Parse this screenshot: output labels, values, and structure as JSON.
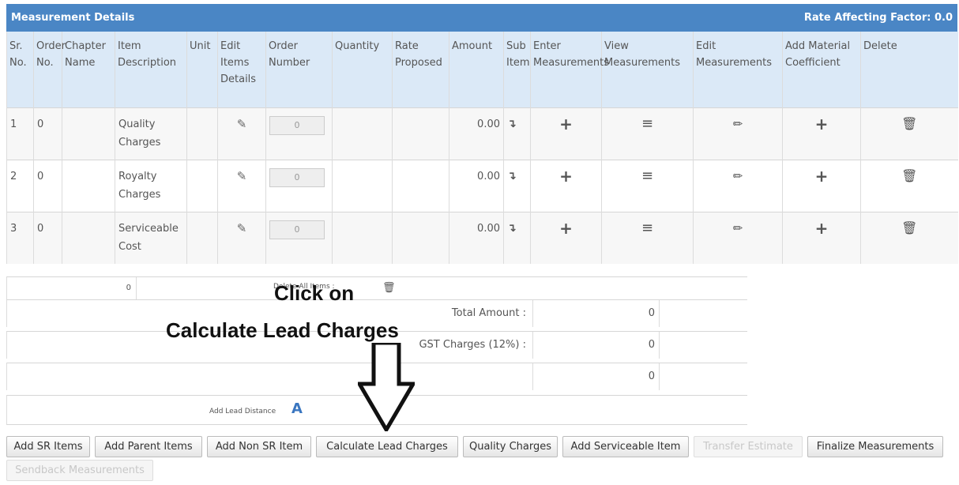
{
  "header": {
    "title": "Measurement Details",
    "rate_factor": "Rate Affecting Factor: 0.0"
  },
  "columns": {
    "sr": "Sr. No.",
    "order": "Order No.",
    "chapter": "Chapter Name",
    "item": "Item Description",
    "unit": "Unit",
    "edit_items": "Edit Items Details",
    "order_number": "Order Number",
    "quantity": "Quantity",
    "rate": "Rate Proposed",
    "amount": "Amount",
    "sub": "Sub Item",
    "enter": "Enter Measurements",
    "view": "View Measurements",
    "edit_meas": "Edit Measurements",
    "material": "Add Material Coefficient",
    "delete": "Delete"
  },
  "rows": [
    {
      "sr": "1",
      "order": "0",
      "item": "Quality Charges",
      "order_number": "0",
      "amount": "0.00"
    },
    {
      "sr": "2",
      "order": "0",
      "item": "Royalty Charges",
      "order_number": "0",
      "amount": "0.00"
    },
    {
      "sr": "3",
      "order": "0",
      "item": "Serviceable Cost",
      "order_number": "0",
      "amount": "0.00"
    }
  ],
  "footer": {
    "count": "0",
    "delete_all": "Delete All Items :",
    "total_label": "Total Amount :",
    "total_value": "0",
    "gst_label": "GST Charges (12%) :",
    "gst_value": "0",
    "grand_value": "0",
    "lead_label": "Add Lead Distance"
  },
  "callout": {
    "line1": "Click on",
    "line2": "Calculate Lead Charges"
  },
  "buttons": {
    "add_sr": "Add SR Items",
    "add_parent": "Add Parent Items",
    "add_non_sr": "Add Non SR Item",
    "calc_lead": "Calculate Lead Charges",
    "quality": "Quality Charges",
    "add_serviceable": "Add Serviceable Item",
    "transfer": "Transfer Estimate",
    "finalize": "Finalize Measurements",
    "sendback": "Sendback Measurements"
  },
  "icons": {
    "edit": "edit-icon",
    "sub": "sub-item-icon",
    "plus": "plus-icon",
    "menu": "list-icon",
    "pencil": "pencil-icon",
    "trash": "trash-icon",
    "lead": "road-icon"
  },
  "colors": {
    "header_bg": "#4a86c5",
    "thead_bg": "#dbe9f7",
    "lead_icon": "#3a76c0"
  }
}
